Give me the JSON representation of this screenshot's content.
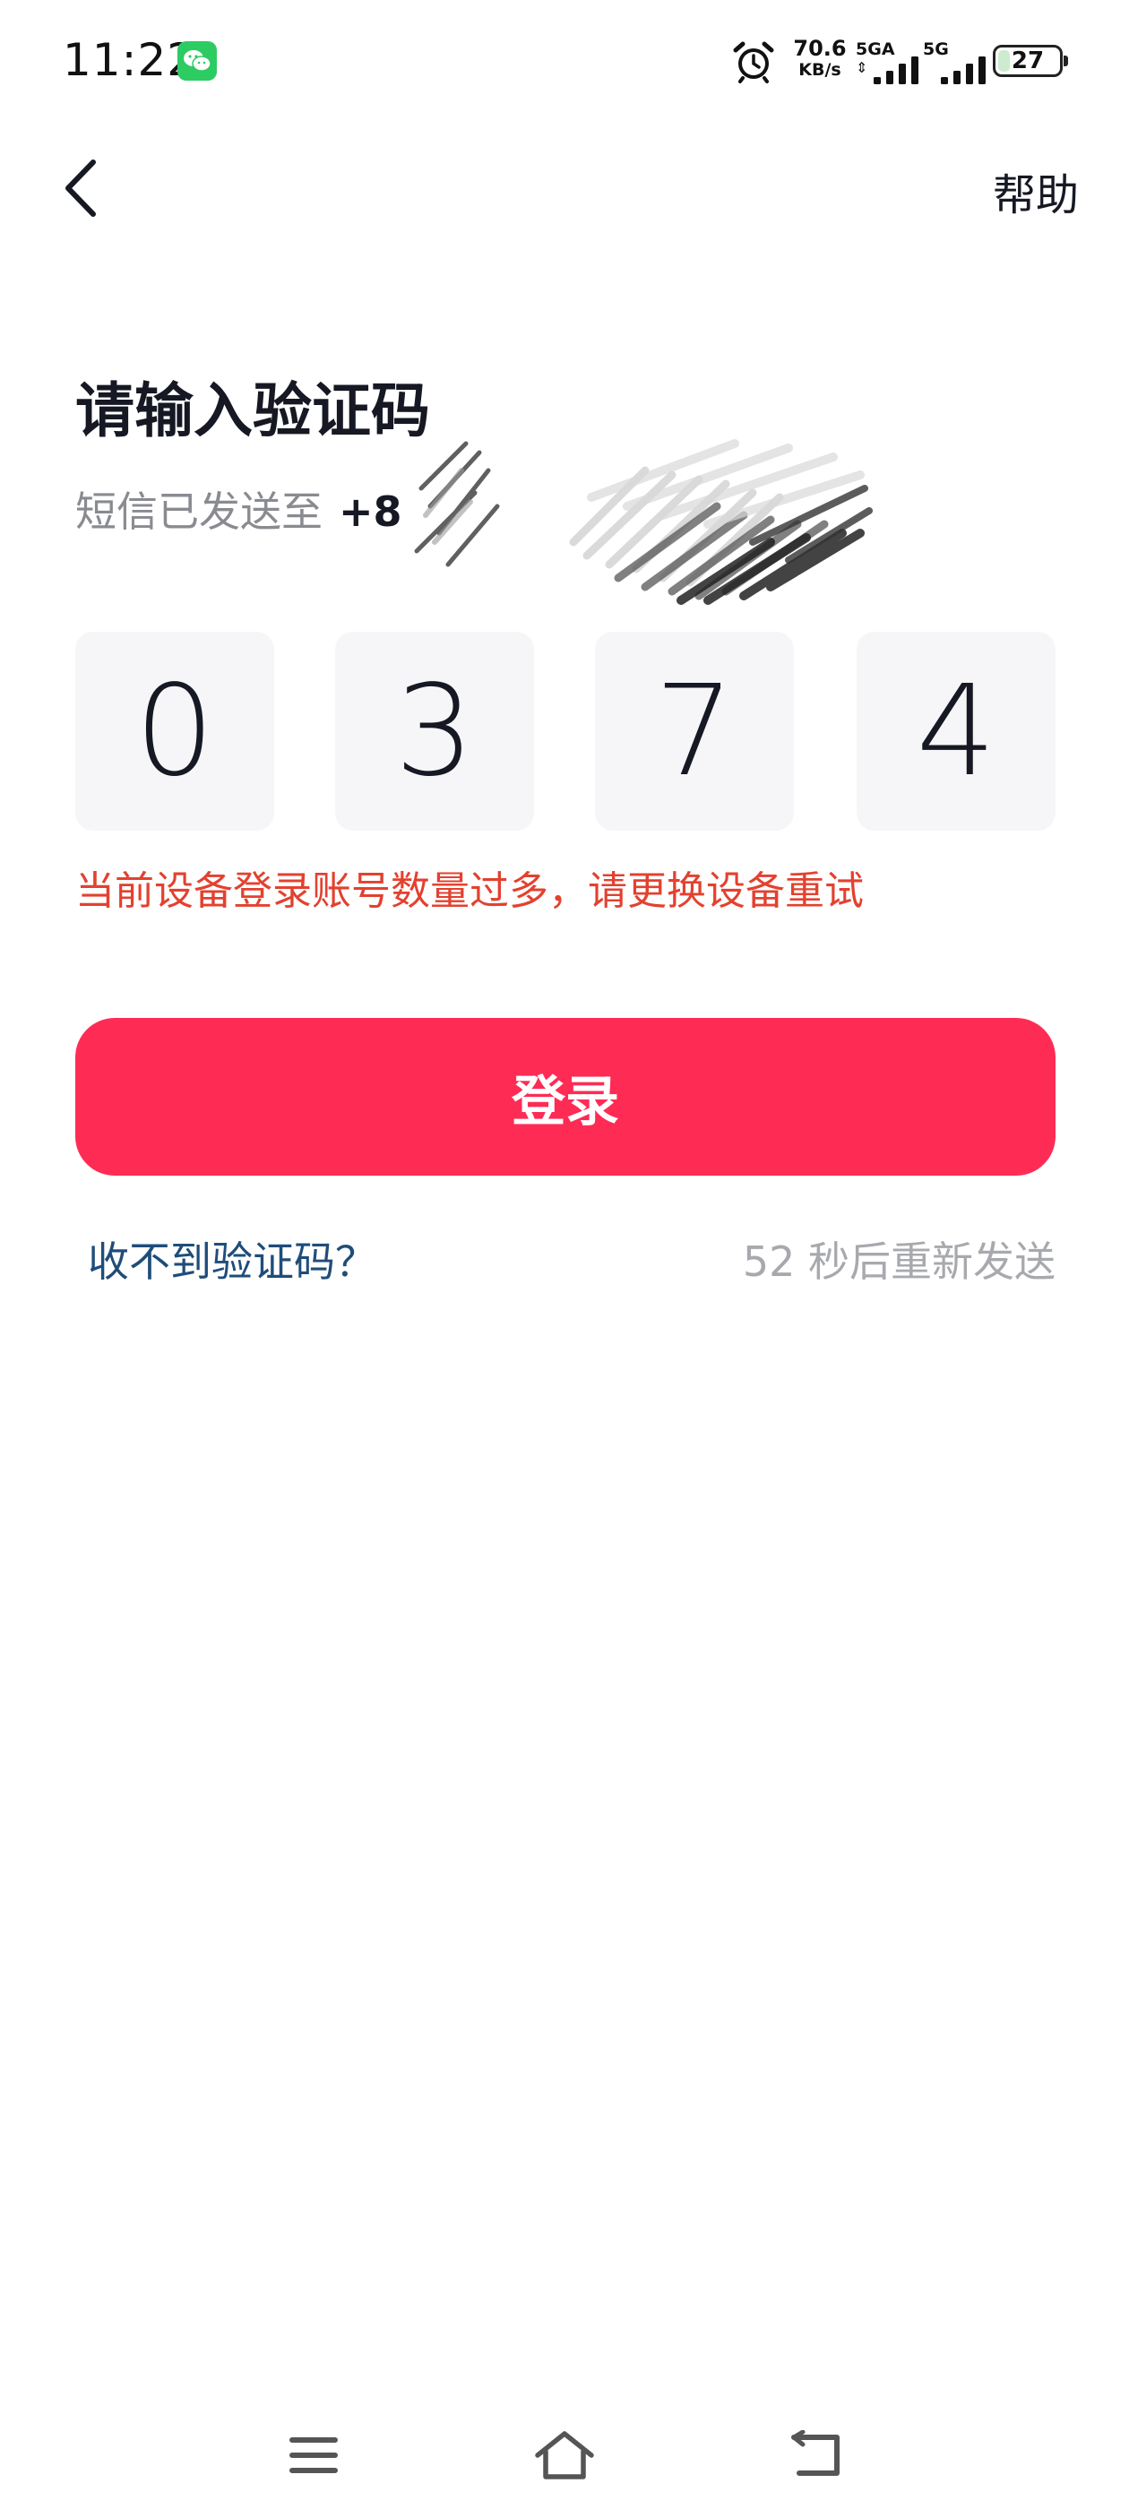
{
  "status_bar": {
    "time": "11:22",
    "notification_icons": [
      "wechat-icon"
    ],
    "alarm_icon": "alarm-clock-icon",
    "net_speed_value": "70.6",
    "net_speed_unit": "KB/s",
    "sim1_label": "5GA",
    "sim2_label": "5G",
    "battery_level": "27",
    "colors": {
      "wechat": "#2ccc63",
      "battery_fill": "#cdeccf"
    }
  },
  "header": {
    "back_icon": "chevron-left-icon",
    "help_label": "帮助"
  },
  "main": {
    "title": "请输入验证码",
    "sms_hint_prefix": "短信已发送至",
    "phone_visible": "+8",
    "code_digits": [
      "0",
      "3",
      "7",
      "4"
    ],
    "error_message": "当前设备登录账号数量过多，请更换设备重试",
    "login_button_label": "登录",
    "no_code_link": "收不到验证码？",
    "resend_countdown": "52 秒后重新发送",
    "colors": {
      "primary": "#fe2c55",
      "error": "#e3412f",
      "link": "#1f4d7a",
      "muted": "#a8a9ae",
      "code_box_bg": "#f6f6f8"
    }
  },
  "nav_bar": {
    "menu_icon": "menu-icon",
    "home_icon": "home-icon",
    "back_icon": "back-arrow-icon"
  }
}
